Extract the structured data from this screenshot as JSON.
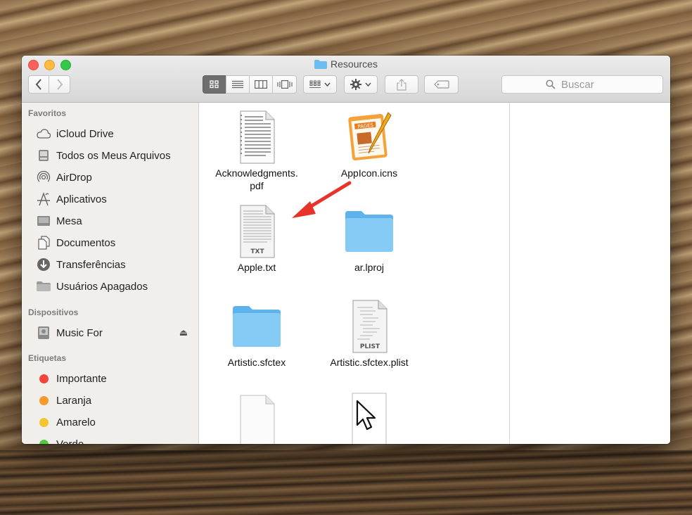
{
  "window": {
    "title": "Resources"
  },
  "toolbar": {
    "back_icon": "chevron-left",
    "forward_icon": "chevron-right",
    "view_icons": [
      "icon-view",
      "list-view",
      "column-view",
      "cover-flow-view"
    ],
    "arrange_icon": "arrange-grid",
    "action_icon": "gear",
    "share_icon": "share",
    "tag_icon": "tag"
  },
  "search": {
    "placeholder": "Buscar"
  },
  "sidebar": {
    "favorites_heading": "Favoritos",
    "favorites": [
      {
        "label": "iCloud Drive",
        "icon": "cloud-icon"
      },
      {
        "label": "Todos os Meus Arquivos",
        "icon": "all-files-icon"
      },
      {
        "label": "AirDrop",
        "icon": "airdrop-icon"
      },
      {
        "label": "Aplicativos",
        "icon": "applications-icon"
      },
      {
        "label": "Mesa",
        "icon": "desktop-icon"
      },
      {
        "label": "Documentos",
        "icon": "documents-icon"
      },
      {
        "label": "Transferências",
        "icon": "downloads-icon"
      },
      {
        "label": "Usuários Apagados",
        "icon": "folder-icon"
      }
    ],
    "devices_heading": "Dispositivos",
    "devices": [
      {
        "label": "Music For",
        "icon": "disk-icon",
        "eject": "⏏"
      }
    ],
    "tags_heading": "Etiquetas",
    "tags": [
      {
        "label": "Importante",
        "color": "#f2463d"
      },
      {
        "label": "Laranja",
        "color": "#f59a2b"
      },
      {
        "label": "Amarelo",
        "color": "#f5c52f"
      },
      {
        "label": "Verde",
        "color": "#4fcb3d"
      }
    ]
  },
  "files": [
    {
      "name": "Acknowledgments.\npdf",
      "icon": "pdf-document-icon"
    },
    {
      "name": "AppIcon.icns",
      "icon": "pages-app-icon"
    },
    {
      "name": "Apple.txt",
      "icon": "txt-document-icon",
      "badge": "TXT"
    },
    {
      "name": "ar.lproj",
      "icon": "folder-icon"
    },
    {
      "name": "Artistic.sfctex",
      "icon": "folder-icon"
    },
    {
      "name": "Artistic.sfctex.plist",
      "icon": "plist-document-icon",
      "badge": "PLIST"
    },
    {
      "name": "",
      "icon": "blank-document-icon"
    },
    {
      "name": "",
      "icon": "cursor-image-icon"
    }
  ],
  "annotation": {
    "color": "#e8332a",
    "icon": "red-arrow"
  }
}
